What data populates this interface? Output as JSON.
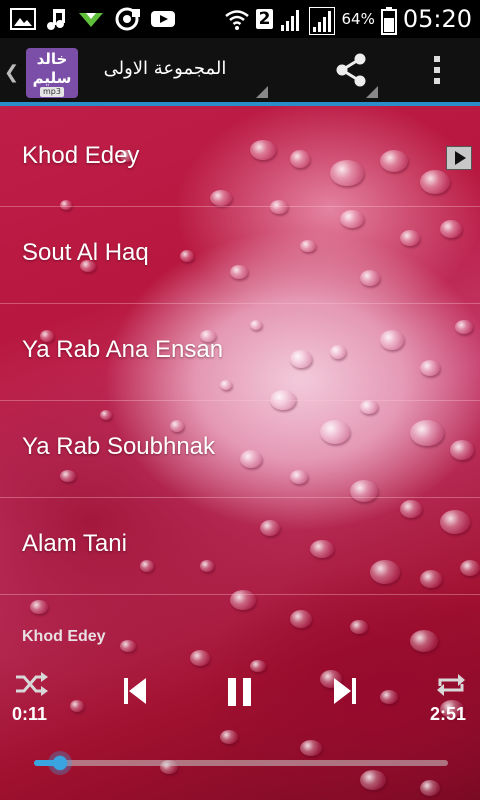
{
  "status_bar": {
    "sim_slot": "2",
    "battery_percent": "64%",
    "time": "05:20",
    "icons": [
      "image-icon",
      "music-icon",
      "download-icon",
      "media-icon",
      "youtube-icon",
      "wifi-icon",
      "signal-icon",
      "signal-icon",
      "battery-icon"
    ]
  },
  "action_bar": {
    "logo": {
      "line1": "خالد",
      "line2": "سليم",
      "badge": "mp3"
    },
    "title": "المجموعة الاولى",
    "accent_color": "#2a8fc8"
  },
  "tracks": [
    {
      "title": "Khod Edey",
      "playing": true
    },
    {
      "title": "Sout Al Haq",
      "playing": false
    },
    {
      "title": "Ya Rab Ana Ensan",
      "playing": false
    },
    {
      "title": "Ya Rab Soubhnak",
      "playing": false
    },
    {
      "title": "Alam Tani",
      "playing": false
    }
  ],
  "player": {
    "now_playing": "Khod Edey",
    "current_time": "0:11",
    "total_time": "2:51",
    "progress_fraction": 0.064,
    "progress_color": "#3aa4e0"
  }
}
